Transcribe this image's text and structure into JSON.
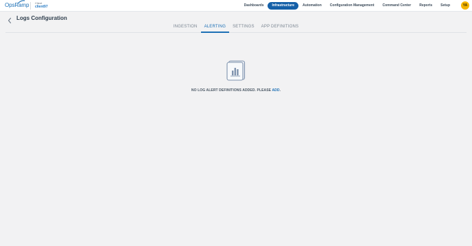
{
  "header": {
    "logo_text": "OpsRamp",
    "client_label": "Client",
    "client_name": "client97",
    "nav_items": [
      {
        "label": "Dashboards",
        "active": false
      },
      {
        "label": "Infrastructure",
        "active": true
      },
      {
        "label": "Automation",
        "active": false
      },
      {
        "label": "Configuration Management",
        "active": false
      },
      {
        "label": "Command Center",
        "active": false
      },
      {
        "label": "Reports",
        "active": false
      },
      {
        "label": "Setup",
        "active": false
      }
    ],
    "avatar_initials": "YA",
    "colors": {
      "brand": "#1b6fb5",
      "active_nav": "#1560a8",
      "avatar": "#f5b400"
    }
  },
  "page": {
    "title": "Logs Configuration",
    "back_icon": "chevron-left-icon"
  },
  "tabs": [
    {
      "label": "INGESTION",
      "active": false
    },
    {
      "label": "ALERTING",
      "active": true
    },
    {
      "label": "SETTINGS",
      "active": false
    },
    {
      "label": "APP DEFINITIONS",
      "active": false
    }
  ],
  "empty_state": {
    "icon": "bar-chart-document-icon",
    "message": "NO LOG ALERT DEFINITIONS ADDED. PLEASE",
    "link_text": "ADD",
    "suffix": "."
  }
}
